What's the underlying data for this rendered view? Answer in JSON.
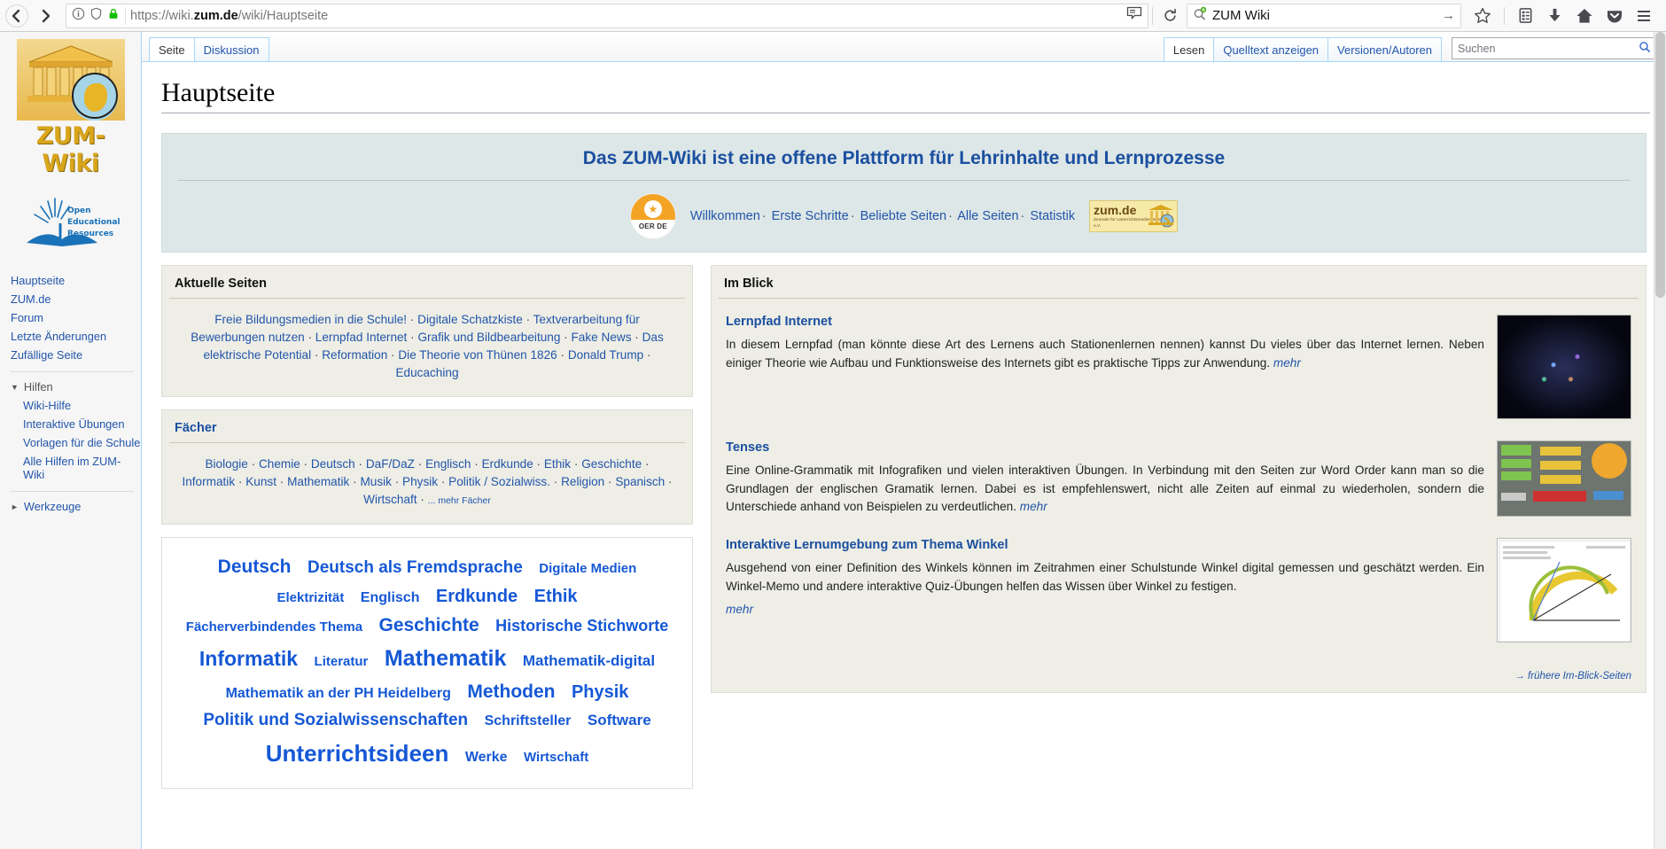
{
  "browser": {
    "back_icon": "back-arrow-icon",
    "forward_icon": "forward-arrow-icon",
    "info_icon": "info-icon",
    "shield_icon": "shield-icon",
    "lock_icon": "lock-icon",
    "url_prefix": "https://wiki.",
    "url_domain": "zum.de",
    "url_suffix": "/wiki/Hauptseite",
    "reader_icon": "reader-view-icon",
    "reload_icon": "reload-icon",
    "search_value": "ZUM Wiki",
    "search_icon": "search-add-icon",
    "search_go_icon": "go-arrow-icon",
    "bookmark_icon": "star-icon",
    "library_icon": "library-icon",
    "download_icon": "download-icon",
    "home_icon": "home-icon",
    "pocket_icon": "pocket-icon",
    "menu_icon": "hamburger-menu-icon"
  },
  "sidebar": {
    "logo_word": "ZUM-Wiki",
    "oer_logo_lines": [
      "Open",
      "Educational",
      "Resources"
    ],
    "links": [
      {
        "label": "Hauptseite"
      },
      {
        "label": "ZUM.de"
      },
      {
        "label": "Forum"
      },
      {
        "label": "Letzte Änderungen"
      },
      {
        "label": "Zufällige Seite"
      }
    ],
    "help_group": {
      "label": "Hilfen",
      "expanded": true,
      "items": [
        {
          "label": "Wiki-Hilfe"
        },
        {
          "label": "Interaktive Übungen"
        },
        {
          "label": "Vorlagen für die Schule"
        },
        {
          "label": "Alle Hilfen im ZUM-Wiki"
        }
      ]
    },
    "tools_group": {
      "label": "Werkzeuge",
      "expanded": false
    }
  },
  "tabs": {
    "left": [
      {
        "label": "Seite",
        "active": true
      },
      {
        "label": "Diskussion",
        "active": false
      }
    ],
    "right": [
      {
        "label": "Lesen",
        "active": true
      },
      {
        "label": "Quelltext anzeigen",
        "active": false
      },
      {
        "label": "Versionen/Autoren",
        "active": false
      }
    ],
    "search_placeholder": "Suchen",
    "search_icon": "magnifier-icon"
  },
  "page": {
    "title": "Hauptseite"
  },
  "banner": {
    "title": "Das ZUM-Wiki ist eine offene Plattform für Lehrinhalte und Lernprozesse",
    "badge": {
      "name": "oer-award-badge",
      "top_label": "OER",
      "sub_label": "DE"
    },
    "links": [
      "Willkommen",
      "Erste Schritte",
      "Beliebte Seiten",
      "Alle Seiten",
      "Statistik"
    ],
    "separator": "·",
    "zumde": {
      "big": "zum.de",
      "small": "Zentrale für Unterrichtsmedien im Internet e.V."
    }
  },
  "aktuelle_seiten": {
    "heading": "Aktuelle Seiten",
    "links": [
      "Freie Bildungsmedien in die Schule!",
      "Digitale Schatzkiste",
      "Textverarbeitung für Bewerbungen nutzen",
      "Lernpfad Internet",
      "Grafik und Bildbearbeitung",
      "Fake News",
      "Das elektrische Potential",
      "Reformation",
      "Die Theorie von Thünen 1826",
      "Donald Trump",
      "Educaching"
    ]
  },
  "faecher": {
    "heading": "Fächer",
    "links": [
      "Biologie",
      "Chemie",
      "Deutsch",
      "DaF/DaZ",
      "Englisch",
      "Erdkunde",
      "Ethik",
      "Geschichte",
      "Informatik",
      "Kunst",
      "Mathematik",
      "Musik",
      "Physik",
      "Politik / Sozialwiss.",
      "Religion",
      "Spanisch",
      "Wirtschaft"
    ],
    "more_label": "... mehr Fächer"
  },
  "tag_cloud": {
    "tags": [
      {
        "label": "Deutsch",
        "size": 21
      },
      {
        "label": "Deutsch als Fremdsprache",
        "size": 19
      },
      {
        "label": "Digitale Medien",
        "size": 15
      },
      {
        "label": "Elektrizität",
        "size": 15
      },
      {
        "label": "Englisch",
        "size": 16
      },
      {
        "label": "Erdkunde",
        "size": 20
      },
      {
        "label": "Ethik",
        "size": 20
      },
      {
        "label": "Fächerverbindendes Thema",
        "size": 15
      },
      {
        "label": "Geschichte",
        "size": 21
      },
      {
        "label": "Historische Stichworte",
        "size": 18
      },
      {
        "label": "Informatik",
        "size": 23
      },
      {
        "label": "Literatur",
        "size": 15
      },
      {
        "label": "Mathematik",
        "size": 25
      },
      {
        "label": "Mathematik-digital",
        "size": 17
      },
      {
        "label": "Mathematik an der PH Heidelberg",
        "size": 16
      },
      {
        "label": "Methoden",
        "size": 21
      },
      {
        "label": "Physik",
        "size": 20
      },
      {
        "label": "Politik und Sozialwissenschaften",
        "size": 19
      },
      {
        "label": "Schriftsteller",
        "size": 16
      },
      {
        "label": "Software",
        "size": 17
      },
      {
        "label": "Unterrichtsideen",
        "size": 26
      },
      {
        "label": "Werke",
        "size": 16
      },
      {
        "label": "Wirtschaft",
        "size": 15
      }
    ]
  },
  "im_blick": {
    "heading": "Im Blick",
    "items": [
      {
        "title": "Lernpfad Internet",
        "text": "In diesem Lernpfad (man könnte diese Art des Lernens auch Stationenlernen nennen) kannst Du vieles über das Internet lernen. Neben einiger Theorie wie Aufbau und Funktionsweise des Internets gibt es praktische Tipps zur Anwendung.",
        "more": "mehr",
        "thumb": "network-graph-thumbnail"
      },
      {
        "title": "Tenses",
        "text": "Eine Online-Grammatik mit Infografiken und vielen interaktiven Übungen. In Verbindung mit den Seiten zur Word Order kann man so die Grundlagen der englischen Gramatik lernen. Dabei es ist empfehlenswert, nicht alle Zeiten auf einmal zu wiederholen, sondern die Unterschiede anhand von Beispielen zu verdeutlichen.",
        "more": "mehr",
        "thumb": "tenses-infographic-thumbnail"
      },
      {
        "title": "Interaktive Lernumgebung zum Thema Winkel",
        "text": "Ausgehend von einer Definition des Winkels können im Zeitrahmen einer Schulstunde Winkel digital gemessen und geschätzt werden. Ein Winkel-Memo und andere interaktive Quiz-Übungen helfen das Wissen über Winkel zu festigen.",
        "more": "mehr",
        "thumb": "protractor-diagram-thumbnail"
      }
    ],
    "footer_link": "→ frühere Im-Blick-Seiten"
  },
  "colors": {
    "link": "#2255aa",
    "heading": "#1b4fa0",
    "banner_bg": "#dde7e7",
    "box_bg": "#eeeee6",
    "cloud_link": "#1558d6"
  }
}
